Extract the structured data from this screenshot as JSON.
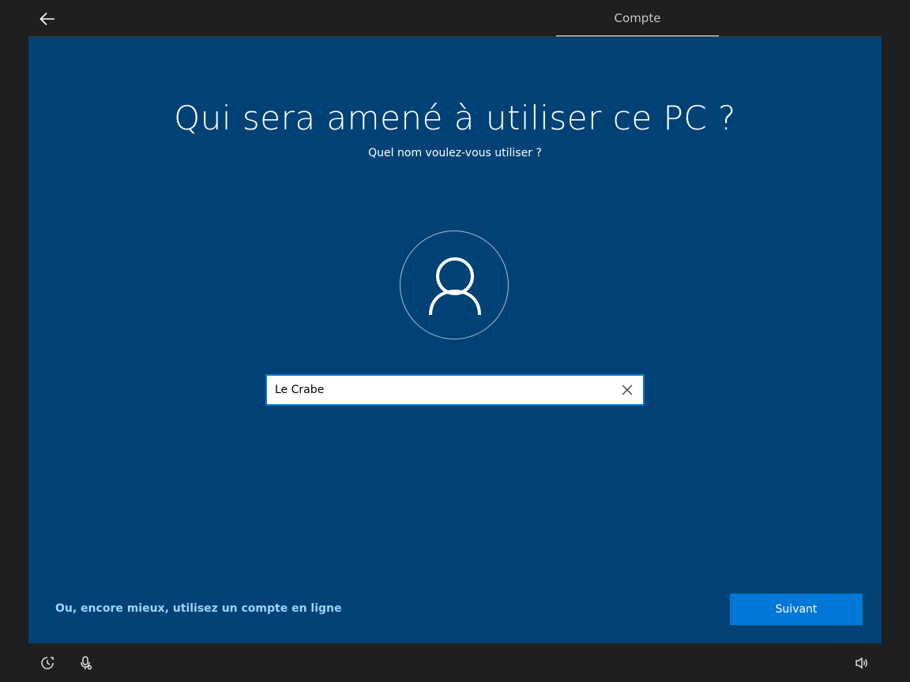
{
  "header": {
    "back_icon": "back-arrow-icon",
    "tab_label": "Compte"
  },
  "main": {
    "title": "Qui sera amené à utiliser ce PC ?",
    "subtitle": "Quel nom voulez-vous utiliser ?",
    "avatar_icon": "user-icon",
    "name_input_value": "Le Crabe",
    "clear_icon": "close-icon",
    "online_account_link": "Ou, encore mieux, utilisez un compte en ligne",
    "next_button": "Suivant"
  },
  "footer": {
    "accessibility_icon": "ease-of-access-icon",
    "microphone_icon": "microphone-icon",
    "volume_icon": "volume-icon"
  },
  "colors": {
    "panel_background": "#004275",
    "accent": "#0078d7",
    "link": "#9fd3ff",
    "chrome": "#1f1f1f"
  }
}
